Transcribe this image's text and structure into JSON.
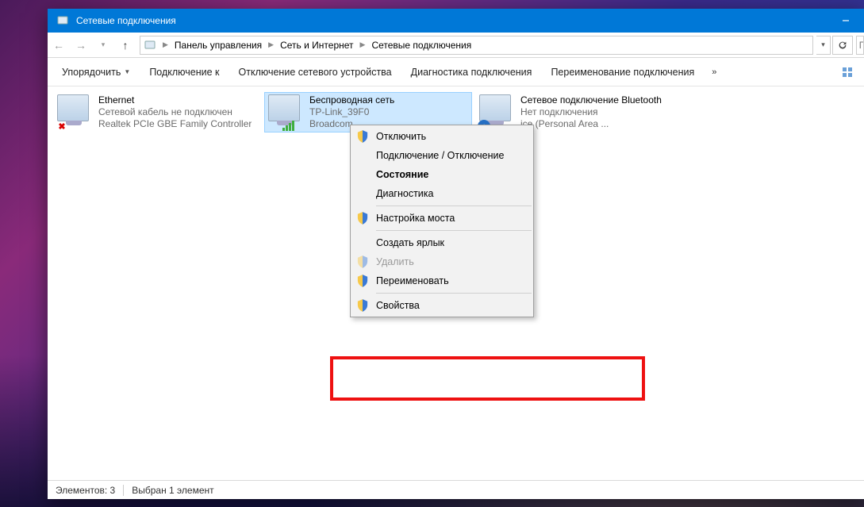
{
  "window": {
    "title": "Сетевые подключения"
  },
  "breadcrumb": {
    "p1": "Панель управления",
    "p2": "Сеть и Интернет",
    "p3": "Сетевые подключения"
  },
  "search": {
    "placeholder": "П"
  },
  "toolbar": {
    "organize": "Упорядочить",
    "connect_to": "Подключение к",
    "disable": "Отключение сетевого устройства",
    "diagnose": "Диагностика подключения",
    "rename": "Переименование подключения",
    "overflow": "»"
  },
  "connections": [
    {
      "name": "Ethernet",
      "sub1": "Сетевой кабель не подключен",
      "sub2": "Realtek PCIe GBE Family Controller"
    },
    {
      "name": "Беспроводная сеть",
      "sub1": "TP-Link_39F0",
      "sub2": "Broadcom"
    },
    {
      "name": "Сетевое подключение Bluetooth",
      "sub1": "Нет подключения",
      "sub2": "ice (Personal Area ..."
    }
  ],
  "context_menu": {
    "disable": "Отключить",
    "connect": "Подключение / Отключение",
    "status": "Состояние",
    "diag": "Диагностика",
    "bridge": "Настройка моста",
    "shortcut": "Создать ярлык",
    "delete": "Удалить",
    "rename": "Переименовать",
    "props": "Свойства"
  },
  "statusbar": {
    "count": "Элементов: 3",
    "selected": "Выбран 1 элемент"
  }
}
